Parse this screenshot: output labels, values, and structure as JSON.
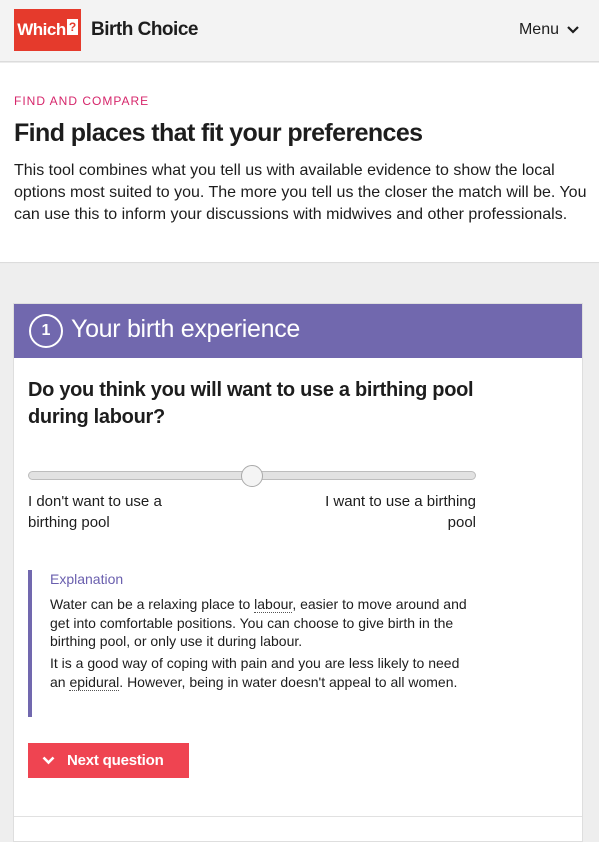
{
  "header": {
    "logo_text": "Which",
    "logo_mark": "?",
    "brand": "Birth Choice",
    "menu_label": "Menu",
    "menu_icon": "chevron-down-icon"
  },
  "intro": {
    "kicker": "FIND AND COMPARE",
    "title": "Find places that fit your preferences",
    "description": "This tool combines what you tell us with available evidence to show the local options most suited to you. The more you tell us the closer the match will be. You can use this to inform your discussions with midwives and other professionals."
  },
  "step": {
    "number": "1",
    "title": "Your birth experience"
  },
  "question": {
    "text": "Do you think you will want to use a birthing pool during labour?",
    "slider": {
      "value": 0.5,
      "left_label": "I don't want to use a birthing pool",
      "right_label": "I want to use a birthing pool"
    }
  },
  "explanation": {
    "heading": "Explanation",
    "p1_a": "Water can be a relaxing place to ",
    "p1_term": "labour",
    "p1_b": ", easier to move around and get into comfortable positions. You can choose to give birth in the birthing pool, or only use it during labour.",
    "p2_a": "It is a good way of coping with pain and you are less likely to need an ",
    "p2_term": "epidural",
    "p2_b": ". However, being in water doesn't appeal to all women."
  },
  "next_button": {
    "label": "Next question",
    "icon": "chevron-down-icon"
  },
  "colors": {
    "brand_red": "#e53a2c",
    "kicker_pink": "#d6266b",
    "step_purple": "#7168ae",
    "button_red": "#ef4451"
  }
}
